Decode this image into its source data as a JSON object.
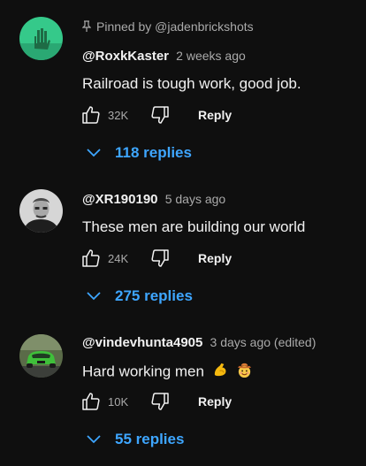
{
  "pinned_label": "Pinned by @jadenbrickshots",
  "comments": [
    {
      "author": "@RoxkKaster",
      "time": "2 weeks ago",
      "text": "Railroad is tough work, good job.",
      "likes": "32K",
      "reply_label": "Reply",
      "replies_label": "118 replies",
      "avatar": "green-hand-avatar"
    },
    {
      "author": "@XR190190",
      "time": "5 days ago",
      "text": "These men are building our world",
      "likes": "24K",
      "reply_label": "Reply",
      "replies_label": "275 replies",
      "avatar": "portrait-avatar"
    },
    {
      "author": "@vindevhunta4905",
      "time": "3 days ago (edited)",
      "text": "Hard working men",
      "emojis": [
        "flexed-biceps-emoji",
        "face-with-cowboy-hat-emoji"
      ],
      "likes": "10K",
      "reply_label": "Reply",
      "replies_label": "55 replies",
      "avatar": "green-car-avatar"
    }
  ],
  "colors": {
    "background": "#0f0f0f",
    "text": "#f1f1f1",
    "secondary": "#aaaaaa",
    "link": "#3ea6ff"
  }
}
